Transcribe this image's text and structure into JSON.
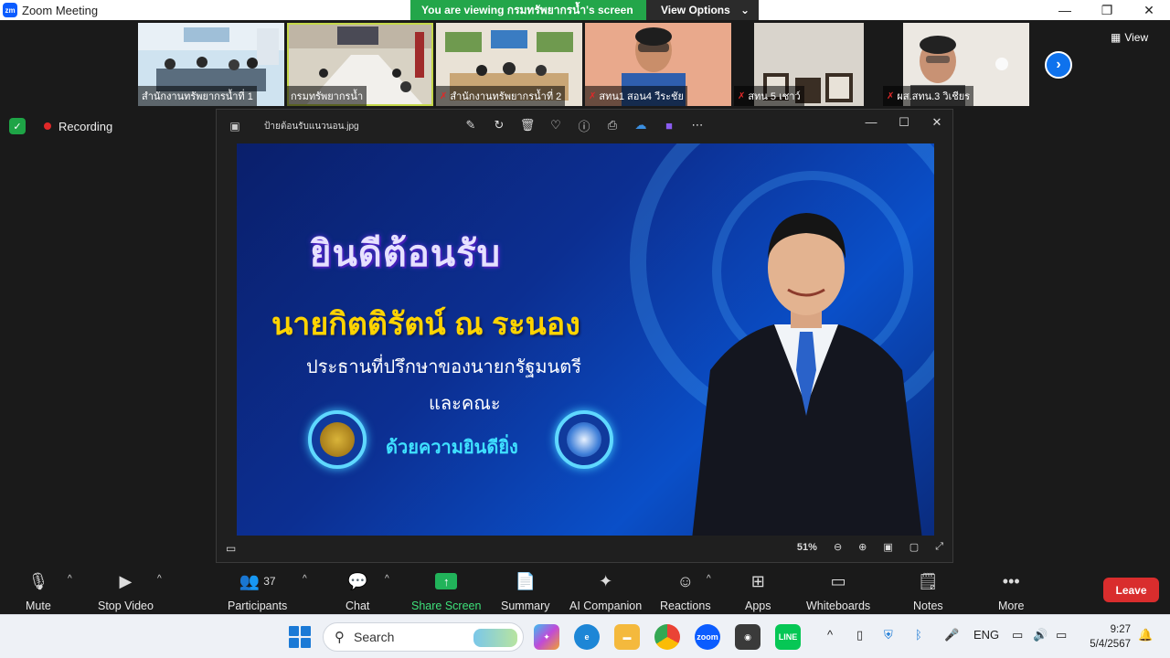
{
  "window": {
    "title": "Zoom Meeting",
    "minimize": "—",
    "maximize": "❐",
    "close": "✕"
  },
  "share_banner": {
    "viewing_text": "You are viewing กรมทรัพยากรน้ำ's screen",
    "view_options": "View Options"
  },
  "view_button": "View",
  "recording_label": "Recording",
  "thumbnails": [
    {
      "name": "สำนักงานทรัพยากรน้ำที่ 1",
      "muted": false
    },
    {
      "name": "กรมทรัพยากรน้ำ",
      "muted": false
    },
    {
      "name": "สำนักงานทรัพยากรน้ำที่ 2",
      "muted": true
    },
    {
      "name": "สทน1 สอน4 วีระชัย",
      "muted": true
    },
    {
      "name": "สทน 5 เชาว์",
      "muted": true
    },
    {
      "name": "ผส.สทน.3 วิเชียร",
      "muted": true
    }
  ],
  "photo_viewer": {
    "filename": "ป้ายต้อนรับแนวนอน.jpg",
    "zoom": "51%"
  },
  "slide": {
    "welcome": "ยินดีต้อนรับ",
    "person": "นายกิตติรัตน์ ณ ระนอง",
    "position": "ประธานที่ปรึกษาของนายกรัฐมนตรี",
    "party": "และคณะ",
    "pleasure": "ด้วยความยินดียิ่ง"
  },
  "controls": {
    "mute": "Mute",
    "stop_video": "Stop Video",
    "participants": "Participants",
    "participants_count": "37",
    "chat": "Chat",
    "share_screen": "Share Screen",
    "summary": "Summary",
    "ai_companion": "AI Companion",
    "reactions": "Reactions",
    "apps": "Apps",
    "whiteboards": "Whiteboards",
    "notes": "Notes",
    "more": "More",
    "leave": "Leave"
  },
  "taskbar": {
    "search_label": "Search",
    "zoom_app": "zoom",
    "line_app": "LINE",
    "language": "ENG",
    "time": "9:27",
    "date": "5/4/2567"
  }
}
